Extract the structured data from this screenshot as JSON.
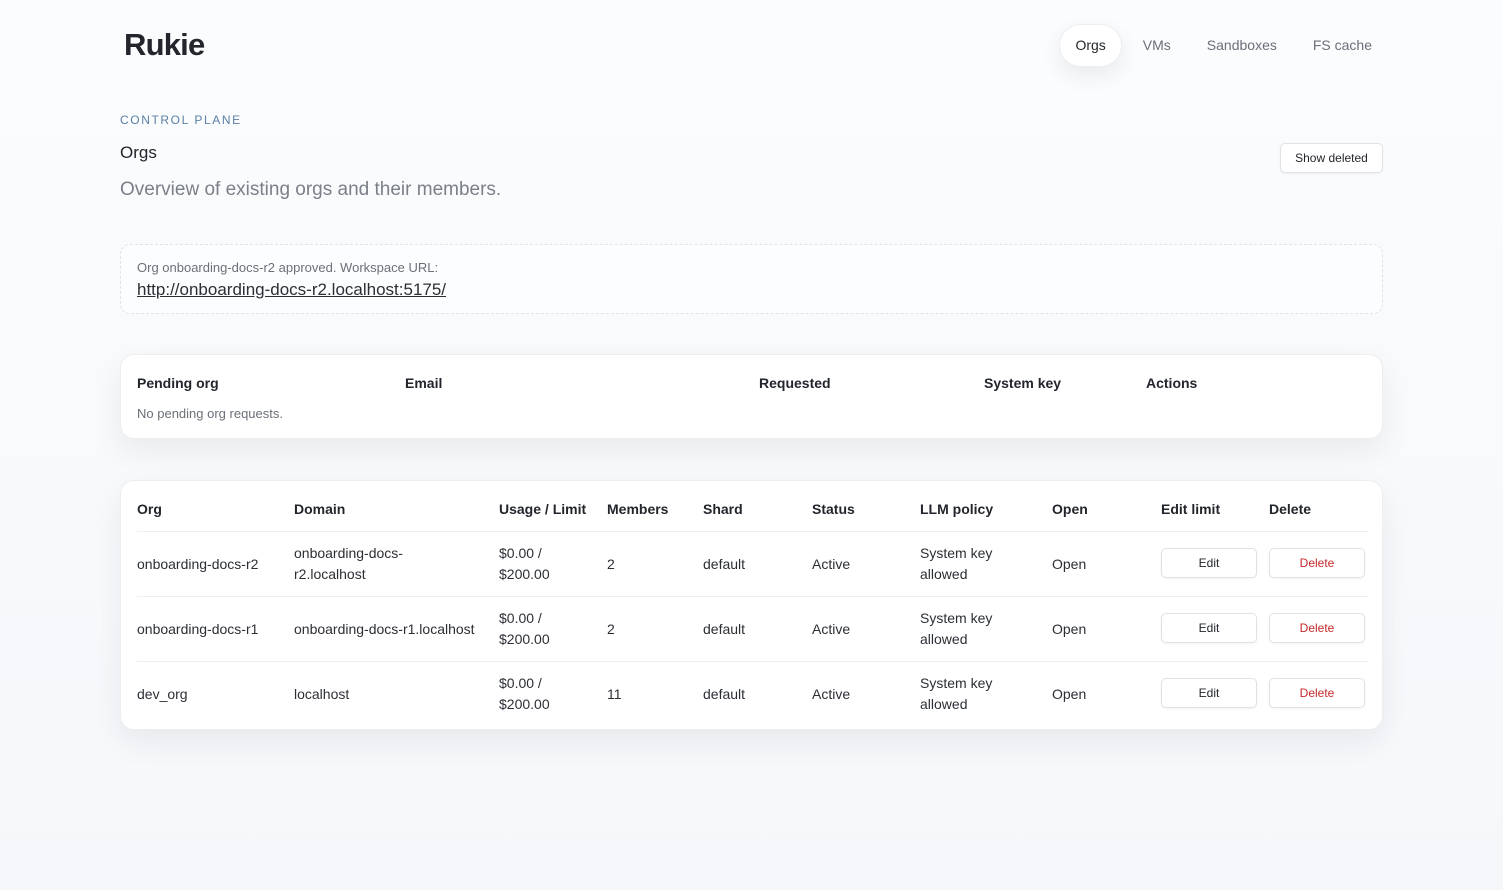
{
  "brand": "Rukie",
  "nav": [
    {
      "label": "Orgs",
      "active": true
    },
    {
      "label": "VMs"
    },
    {
      "label": "Sandboxes"
    },
    {
      "label": "FS cache"
    }
  ],
  "header": {
    "eyebrow": "CONTROL PLANE",
    "title": "Orgs",
    "subtitle": "Overview of existing orgs and their members.",
    "show_deleted_label": "Show deleted"
  },
  "notice": {
    "text": "Org onboarding-docs-r2 approved. Workspace URL:",
    "link": "http://onboarding-docs-r2.localhost:5175/"
  },
  "pending": {
    "columns": [
      "Pending org",
      "Email",
      "Requested",
      "System key",
      "Actions"
    ],
    "empty": "No pending org requests."
  },
  "orgs": {
    "columns": [
      "Org",
      "Domain",
      "Usage / Limit",
      "Members",
      "Shard",
      "Status",
      "LLM policy",
      "Open",
      "Edit limit",
      "Delete"
    ],
    "rows": [
      {
        "org": "onboarding-docs-r2",
        "domain_l1": "onboarding-docs-",
        "domain_l2": "r2.localhost",
        "usage_l1": "$0.00 /",
        "usage_l2": "$200.00",
        "members": "2",
        "shard": "default",
        "status": "Active",
        "policy_l1": "System key",
        "policy_l2": "allowed",
        "open": "Open",
        "edit": "Edit",
        "delete": "Delete"
      },
      {
        "org": "onboarding-docs-r1",
        "domain": "onboarding-docs-r1.localhost",
        "usage_l1": "$0.00 /",
        "usage_l2": "$200.00",
        "members": "2",
        "shard": "default",
        "status": "Active",
        "policy_l1": "System key",
        "policy_l2": "allowed",
        "open": "Open",
        "edit": "Edit",
        "delete": "Delete"
      },
      {
        "org": "dev_org",
        "domain": "localhost",
        "usage_l1": "$0.00 /",
        "usage_l2": "$200.00",
        "members": "11",
        "shard": "default",
        "status": "Active",
        "policy_l1": "System key",
        "policy_l2": "allowed",
        "open": "Open",
        "edit": "Edit",
        "delete": "Delete"
      }
    ]
  },
  "colors": {
    "accent": "#5b7fa6",
    "danger": "#c62828",
    "text": "#22262c",
    "muted": "#7a7f88"
  }
}
